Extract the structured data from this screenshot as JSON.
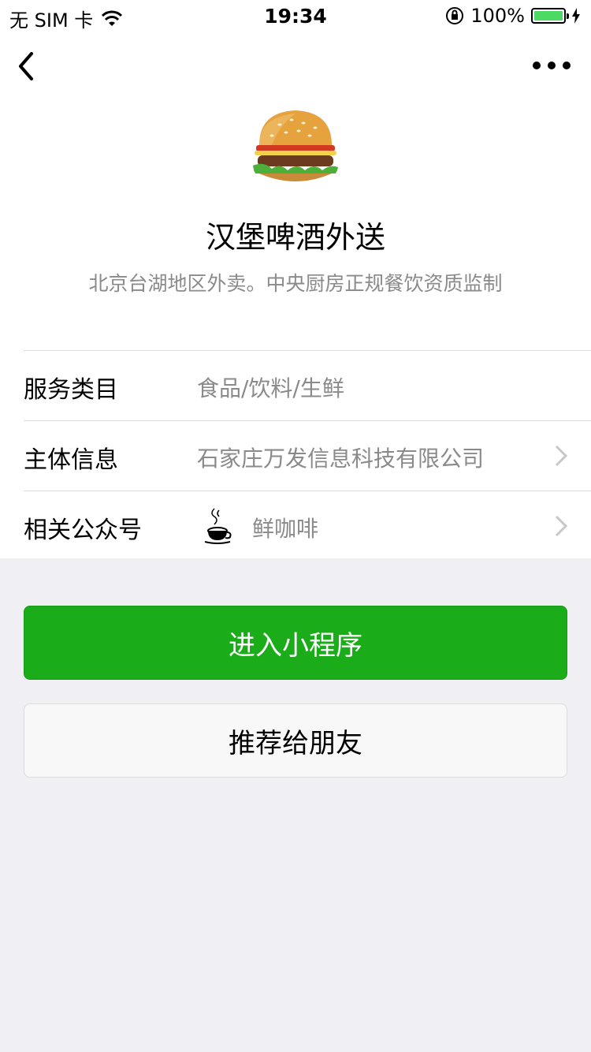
{
  "status_bar": {
    "carrier": "无 SIM 卡",
    "time": "19:34",
    "battery": "100%",
    "battery_level": 1.0
  },
  "nav": {
    "back_icon": "chevron-left-icon",
    "more_icon": "more-dots-icon"
  },
  "profile": {
    "name": "汉堡啤酒外送",
    "description": "北京台湖地区外卖。中央厨房正规餐饮资质监制"
  },
  "info_rows": [
    {
      "label": "服务类目",
      "value": "食品/饮料/生鲜"
    },
    {
      "label": "主体信息",
      "value": "石家庄万发信息科技有限公司"
    },
    {
      "label": "相关公众号",
      "value": "鲜咖啡"
    }
  ],
  "buttons": {
    "primary": "进入小程序",
    "secondary": "推荐给朋友"
  },
  "colors": {
    "primary_green": "#1aad19",
    "background": "#efeff4",
    "secondary_text": "#8a8a8a"
  }
}
